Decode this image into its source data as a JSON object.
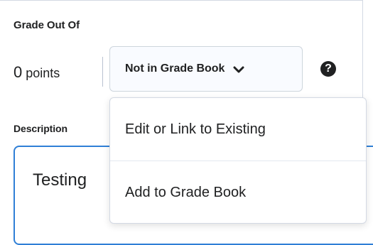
{
  "grade_out_of": {
    "label": "Grade Out Of",
    "points_value": "0",
    "points_unit": "points",
    "dropdown": {
      "selected_label": "Not in Grade Book",
      "icon": "chevron-down-icon"
    },
    "help_icon": "?"
  },
  "description": {
    "label": "Description",
    "text": "Testing"
  },
  "grade_book_menu": {
    "items": [
      {
        "label": "Edit or Link to Existing"
      },
      {
        "label": "Add to Grade Book"
      }
    ]
  },
  "colors": {
    "text": "#202122",
    "focus_border": "#2f7fd6",
    "border": "#cdd5dc"
  }
}
